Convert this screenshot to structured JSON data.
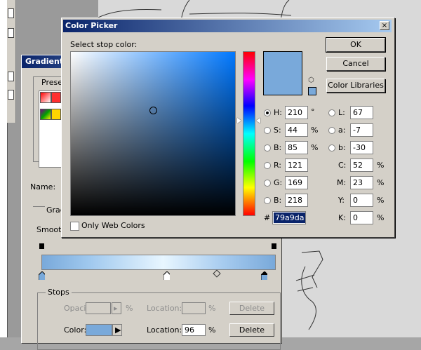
{
  "background": {
    "gradient_editor": {
      "title": "Gradient E",
      "presets_label": "Prese",
      "name_label": "Name:",
      "gradient_type_label": "Grad",
      "smoothness_label": "Smooth",
      "stops_label": "Stops",
      "opacity_label": "Opacity:",
      "opacity_unit": "%",
      "location_label": "Location:",
      "location_unit": "%",
      "delete_label": "Delete",
      "color_label": "Color:",
      "color_swatch": "#79a9da",
      "color_location_value": "96",
      "color_location_unit": "%",
      "color_delete_label": "Delete"
    }
  },
  "color_picker": {
    "title": "Color Picker",
    "close_glyph": "×",
    "select_label": "Select stop color:",
    "current_color": "#79a9da",
    "only_web_colors_label": "Only Web Colors",
    "buttons": {
      "ok": "OK",
      "cancel": "Cancel",
      "libraries": "Color Libraries"
    },
    "hsb": {
      "h_label": "H:",
      "h_value": "210",
      "h_unit": "°",
      "s_label": "S:",
      "s_value": "44",
      "s_unit": "%",
      "b_label": "B:",
      "b_value": "85",
      "b_unit": "%"
    },
    "rgb": {
      "r_label": "R:",
      "r_value": "121",
      "g_label": "G:",
      "g_value": "169",
      "b_label": "B:",
      "b_value": "218"
    },
    "lab": {
      "l_label": "L:",
      "l_value": "67",
      "a_label": "a:",
      "a_value": "-7",
      "b_label": "b:",
      "b_value": "-30"
    },
    "cmyk": {
      "c_label": "C:",
      "c_value": "52",
      "c_unit": "%",
      "m_label": "M:",
      "m_value": "23",
      "m_unit": "%",
      "y_label": "Y:",
      "y_value": "0",
      "y_unit": "%",
      "k_label": "K:",
      "k_value": "0",
      "k_unit": "%"
    },
    "hex_label": "#",
    "hex_value": "79a9da"
  }
}
